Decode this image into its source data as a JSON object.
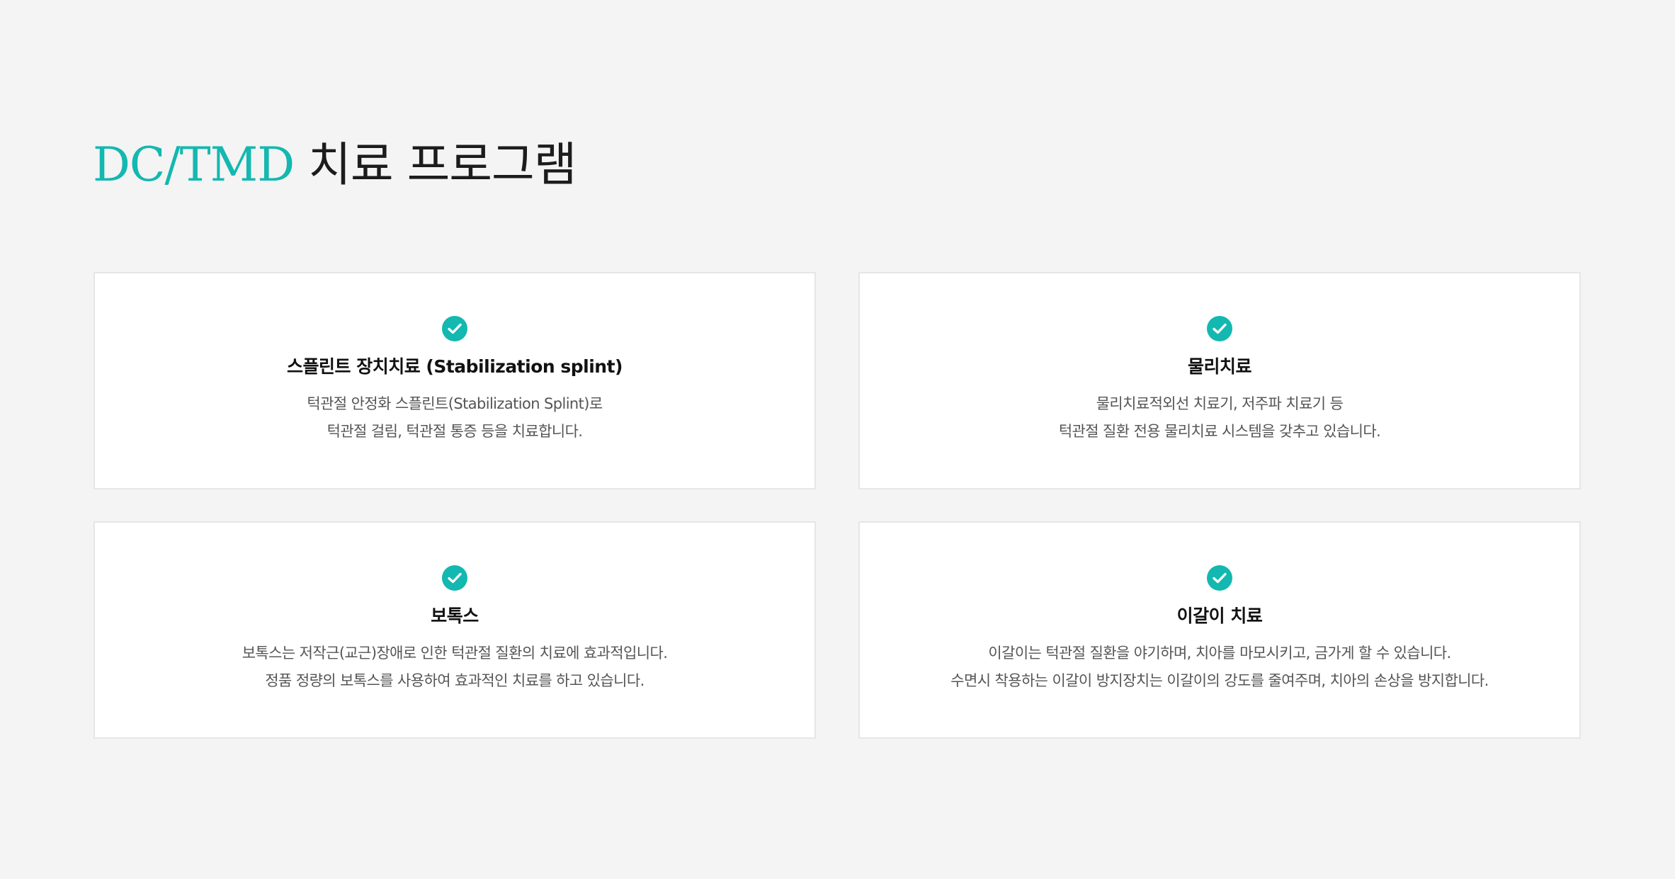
{
  "title": {
    "accent": "DC/TMD",
    "rest": "치료 프로그램",
    "accent_color": "#13b8b0"
  },
  "cards": [
    {
      "icon": "check-circle-icon",
      "title": "스플린트 장치치료 (Stabilization splint)",
      "lines": [
        "턱관절 안정화 스플린트(Stabilization Splint)로",
        "턱관절 걸림, 턱관절 통증 등을 치료합니다."
      ]
    },
    {
      "icon": "check-circle-icon",
      "title": "물리치료",
      "lines": [
        "물리치료적외선 치료기, 저주파 치료기 등",
        "턱관절 질환 전용 물리치료 시스템을 갖추고 있습니다."
      ]
    },
    {
      "icon": "check-circle-icon",
      "title": "보톡스",
      "lines": [
        "보톡스는 저작근(교근)장애로 인한 턱관절 질환의 치료에 효과적입니다.",
        "정품 정량의 보톡스를 사용하여 효과적인 치료를 하고 있습니다."
      ]
    },
    {
      "icon": "check-circle-icon",
      "title": "이갈이 치료",
      "lines": [
        "이갈이는 턱관절 질환을 야기하며, 치아를 마모시키고, 금가게 할 수 있습니다.",
        "수면시 착용하는 이갈이 방지장치는 이갈이의 강도를 줄여주며, 치아의 손상을 방지합니다."
      ]
    }
  ]
}
